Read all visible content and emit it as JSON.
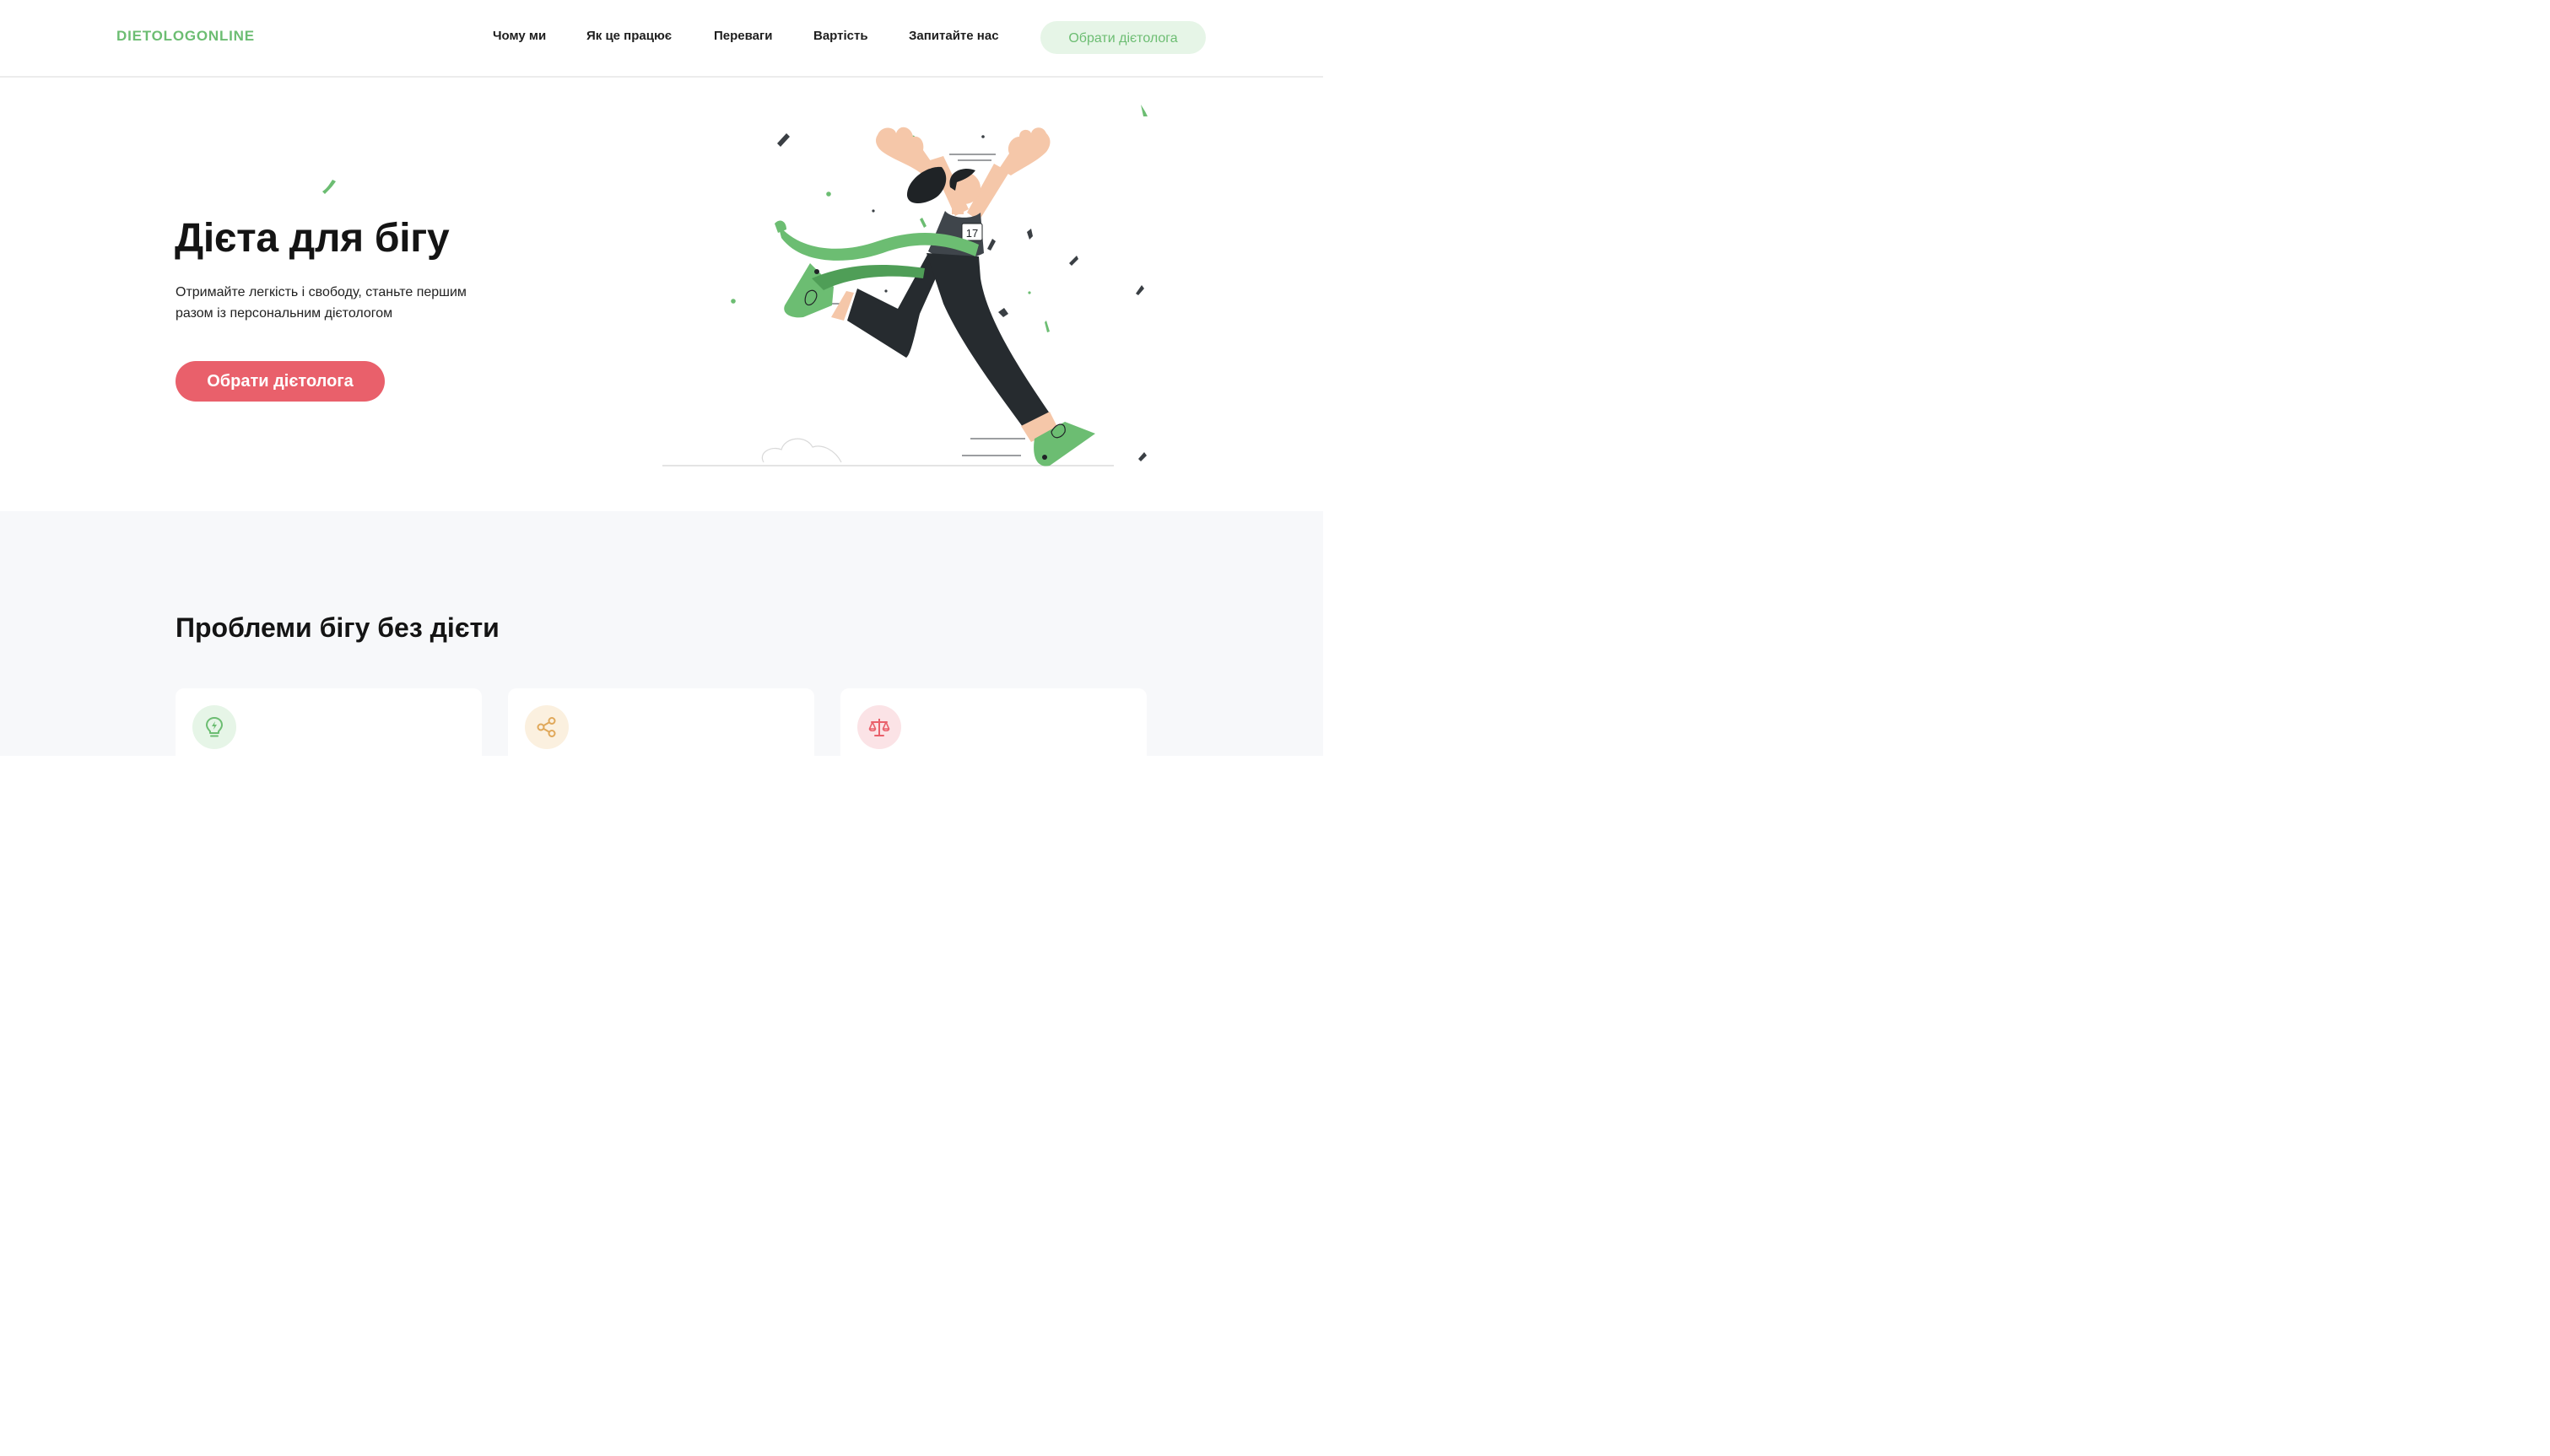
{
  "header": {
    "logo": "DIETOLOGONLINE",
    "nav": [
      {
        "label": "Чому ми"
      },
      {
        "label": "Як це працює"
      },
      {
        "label": "Переваги"
      },
      {
        "label": "Вартість"
      },
      {
        "label": "Запитайте нас"
      }
    ],
    "cta_label": "Обрати дієтолога"
  },
  "hero": {
    "title": "Дієта для бігу",
    "subtitle": "Отримайте легкість і свободу, станьте першим разом із персональним дієтологом",
    "cta_label": "Обрати дієтолога",
    "illustration": "runner-crossing-finish-line",
    "bib_number": "17"
  },
  "problems": {
    "title": "Проблеми бігу без дієти",
    "cards": [
      {
        "icon": "lightbulb-icon",
        "color": "#6cbd72",
        "bg": "#e6f5e7"
      },
      {
        "icon": "share-icon",
        "color": "#e0a85a",
        "bg": "#fbf0df"
      },
      {
        "icon": "scales-icon",
        "color": "#e9606b",
        "bg": "#fbe3e6"
      }
    ]
  },
  "colors": {
    "brand_green": "#6cbd72",
    "accent_red": "#e9606b",
    "section_bg": "#f7f8fa"
  }
}
